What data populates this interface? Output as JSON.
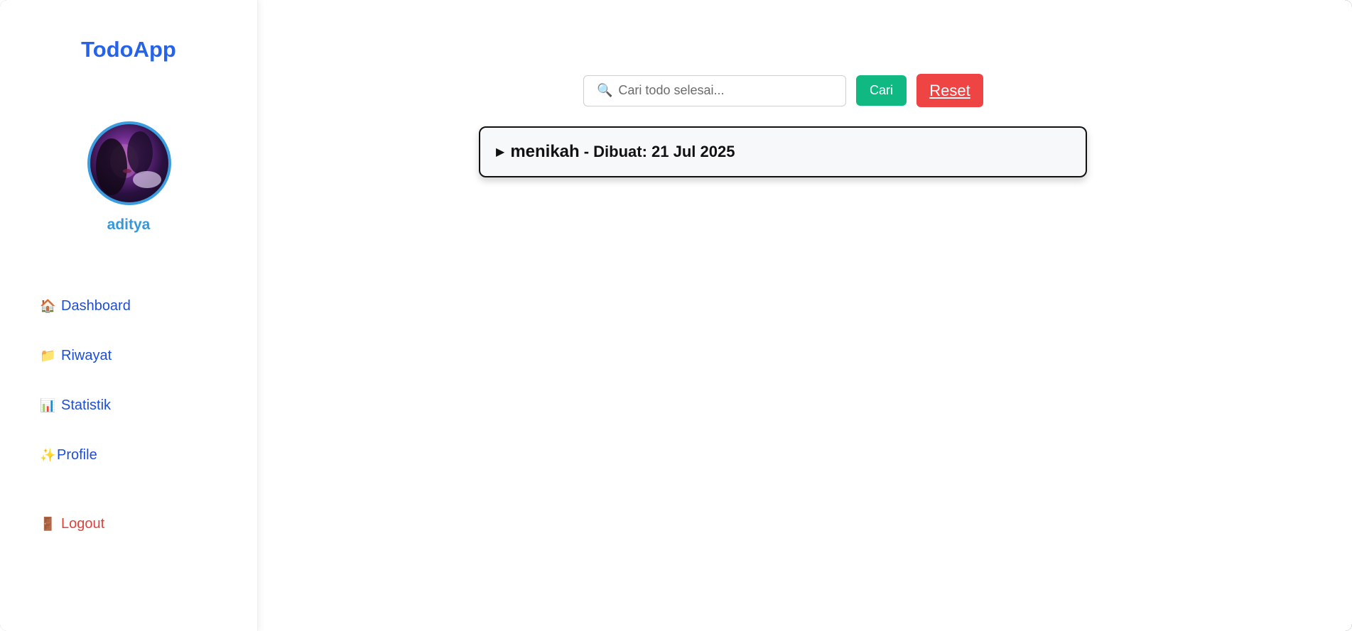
{
  "app": {
    "brand": "TodoApp"
  },
  "user": {
    "name": "aditya"
  },
  "sidebar": {
    "items": [
      {
        "icon": "house-icon",
        "glyph": "🏠",
        "label": "Dashboard"
      },
      {
        "icon": "folder-icon",
        "glyph": "📁",
        "label": "Riwayat"
      },
      {
        "icon": "bar-chart-icon",
        "glyph": "📊",
        "label": "Statistik"
      },
      {
        "icon": "sparkles-icon",
        "glyph": "✨",
        "label": "Profile"
      }
    ],
    "logout": {
      "icon": "door-icon",
      "glyph": "🚪",
      "label": "Logout"
    }
  },
  "search": {
    "icon": "magnifier-icon",
    "glyph": "🔍",
    "placeholder": "Cari todo selesai...",
    "value": "",
    "submit_label": "Cari",
    "reset_label": "Reset"
  },
  "todos": [
    {
      "expander": "▶",
      "title": "menikah",
      "created": "- Dibuat: 21 Jul 2025"
    }
  ],
  "colors": {
    "brand": "#2563eb",
    "username": "#3598db",
    "nav": "#1d4ed8",
    "logout": "#e0413c",
    "search_button": "#10b981",
    "reset_button": "#ef4444"
  }
}
